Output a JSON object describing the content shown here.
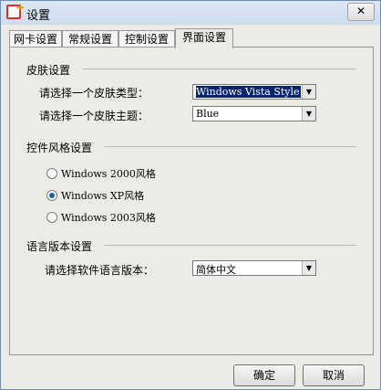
{
  "window": {
    "title": "设置",
    "close_symbol": "✕"
  },
  "tabs": [
    {
      "label": "网卡设置"
    },
    {
      "label": "常规设置"
    },
    {
      "label": "控制设置"
    },
    {
      "label": "界面设置"
    }
  ],
  "skin": {
    "section_title": "皮肤设置",
    "type_label": "请选择一个皮肤类型：",
    "type_value": "Windows Vista Style",
    "theme_label": "请选择一个皮肤主题：",
    "theme_value": "Blue"
  },
  "control_style": {
    "section_title": "控件风格设置",
    "options": [
      {
        "label": "Windows 2000风格",
        "checked": false
      },
      {
        "label": "Windows XP风格",
        "checked": true
      },
      {
        "label": "Windows 2003风格",
        "checked": false
      }
    ]
  },
  "language": {
    "section_title": "语言版本设置",
    "label": "请选择软件语言版本：",
    "value": "简体中文"
  },
  "buttons": {
    "ok": "确定",
    "cancel": "取消"
  },
  "icons": {
    "combo_arrow": "▼"
  }
}
